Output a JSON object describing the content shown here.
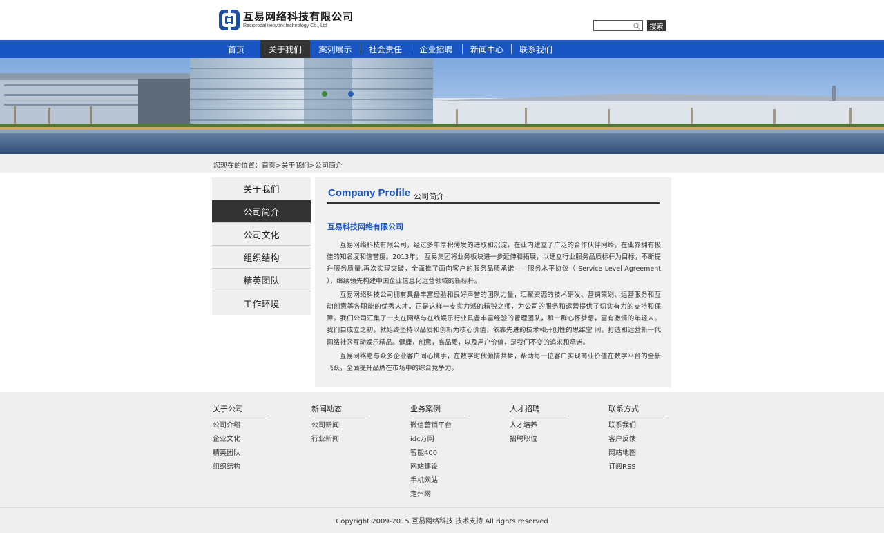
{
  "brand": {
    "name_cn": "互易网络科技有限公司",
    "name_en": "Reciprocal network technology Co., Ltd"
  },
  "search": {
    "placeholder": "",
    "button_label": "搜索"
  },
  "nav": {
    "items": [
      {
        "label": "首页"
      },
      {
        "label": "关于我们"
      },
      {
        "label": "案列展示"
      },
      {
        "label": "社会责任"
      },
      {
        "label": "企业招聘"
      },
      {
        "label": "新闻中心"
      },
      {
        "label": "联系我们"
      }
    ],
    "active": "关于我们"
  },
  "breadcrumb": {
    "text": "您现在的位置：首页>关于我们>公司简介"
  },
  "sidebar": {
    "items": [
      {
        "label": "关于我们"
      },
      {
        "label": "公司简介"
      },
      {
        "label": "公司文化"
      },
      {
        "label": "组织结构"
      },
      {
        "label": "精英团队"
      },
      {
        "label": "工作环境"
      }
    ],
    "active": "公司简介"
  },
  "content": {
    "heading_en": "Company Profile",
    "heading_cn": "公司简介",
    "title": "互易科技网络有限公司",
    "paragraphs": [
      "互易网络科技有限公司，经过多年厚积薄发的进取和沉淀，在业内建立了广泛的合作伙伴网络，在业界拥有极佳的知名度和信誉度。2013年， 互易集团将业务板块进一步延伸和拓展，以建立行业服务品质标杆为目标，不断提升服务质量,再次实现突破，全面推了面向客户的服务品质承诺——服务水平协议（ Service Level Agreement ），继续领先构建中国企业信息化运营领域的新标杆。",
      "互易网络科技公司拥有具备丰富经验和良好声誉的团队力量，汇聚资源的技术研发、营销策划、运营服务和互动创意等各职能的优秀人才。正是这样一支实力派的精锐之师，为公司的服务和运营提供了切实有力的支持和保障。我们公司汇集了一支在网络与在线娱乐行业具备丰富经验的管理团队，和一群心怀梦想，富有激情的年轻人。我们自成立之初，就始终坚持以品质和创新为核心价值，依靠先进的技术和开创性的思维空 间，打造和运营新一代网络社区互动娱乐精品。健康，创意，高品质，以及用户价值，是我们不变的追求和承诺。",
      "互易网络愿与众多企业客户同心携手，在数字时代倾情共舞，帮助每一位客户实现商业价值在数字平台的全新飞跃，全面提升品牌在市场中的综合竞争力。"
    ]
  },
  "footer": {
    "columns": [
      {
        "title": "关于公司",
        "links": [
          "公司介绍",
          "企业文化",
          "精英团队",
          "组织结构"
        ]
      },
      {
        "title": "新闻动态",
        "links": [
          "公司新闻",
          "行业新闻"
        ]
      },
      {
        "title": "业务案例",
        "links": [
          "微信营销平台",
          "idc万网",
          "智能400",
          "网站建设",
          "手机网站",
          "定州网"
        ]
      },
      {
        "title": "人才招聘",
        "links": [
          "人才培养",
          "招聘职位"
        ]
      },
      {
        "title": "联系方式",
        "links": [
          "联系我们",
          "客户反馈",
          "网站地图",
          "订阅RSS"
        ]
      }
    ],
    "copyright": "Copyright 2009-2015 互易网络科技 技术支持 All rights reserved"
  },
  "colors": {
    "brand_blue": "#1a55c4",
    "dark": "#333333",
    "panel_gray": "#efefef"
  },
  "icons": [
    "logo-mark-icon",
    "search-icon"
  ]
}
